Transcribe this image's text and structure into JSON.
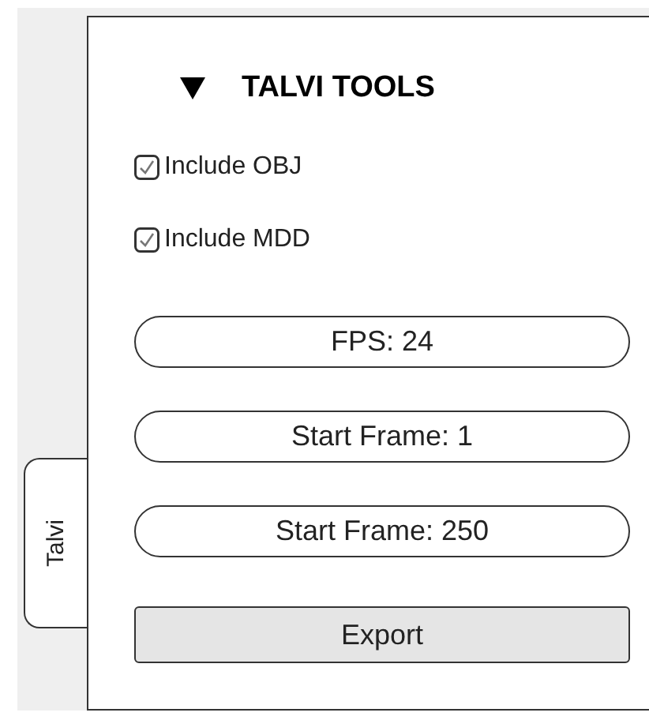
{
  "tab": {
    "label": "Talvi"
  },
  "panel": {
    "title": "TALVI TOOLS",
    "expanded": true,
    "checkboxes": [
      {
        "label": "Include OBJ",
        "checked": true
      },
      {
        "label": "Include MDD",
        "checked": true
      }
    ],
    "fields": [
      {
        "value": "FPS: 24"
      },
      {
        "value": "Start Frame: 1"
      },
      {
        "value": "Start Frame: 250"
      }
    ],
    "button": "Export"
  }
}
